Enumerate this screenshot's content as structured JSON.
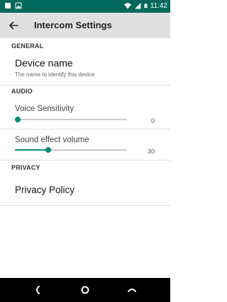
{
  "status_bar": {
    "time": "11:42",
    "left_icons": [
      "notification-icon",
      "image-icon"
    ],
    "right_icons": [
      "wifi-icon",
      "signal-icon",
      "battery-icon"
    ]
  },
  "app_bar": {
    "title": "Intercom Settings",
    "back_icon": "arrow-back-icon"
  },
  "sections": {
    "general": {
      "header": "GENERAL",
      "device_name": {
        "title": "Device name",
        "summary": "The name to identify this device"
      }
    },
    "audio": {
      "header": "AUDIO",
      "voice_sensitivity": {
        "title": "Voice Sensitivity",
        "value": "0",
        "level": 0
      },
      "sound_effect_volume": {
        "title": "Sound effect volume",
        "value": "30",
        "level": 0.3
      }
    },
    "privacy": {
      "header": "PRIVACY",
      "privacy_policy": {
        "title": "Privacy Policy"
      }
    }
  },
  "nav_bar": {
    "buttons": [
      "back-icon",
      "home-icon",
      "recents-icon"
    ]
  },
  "colors": {
    "status_bar": "#00695c",
    "app_bar": "#e0e0e0",
    "accent": "#00897b"
  }
}
